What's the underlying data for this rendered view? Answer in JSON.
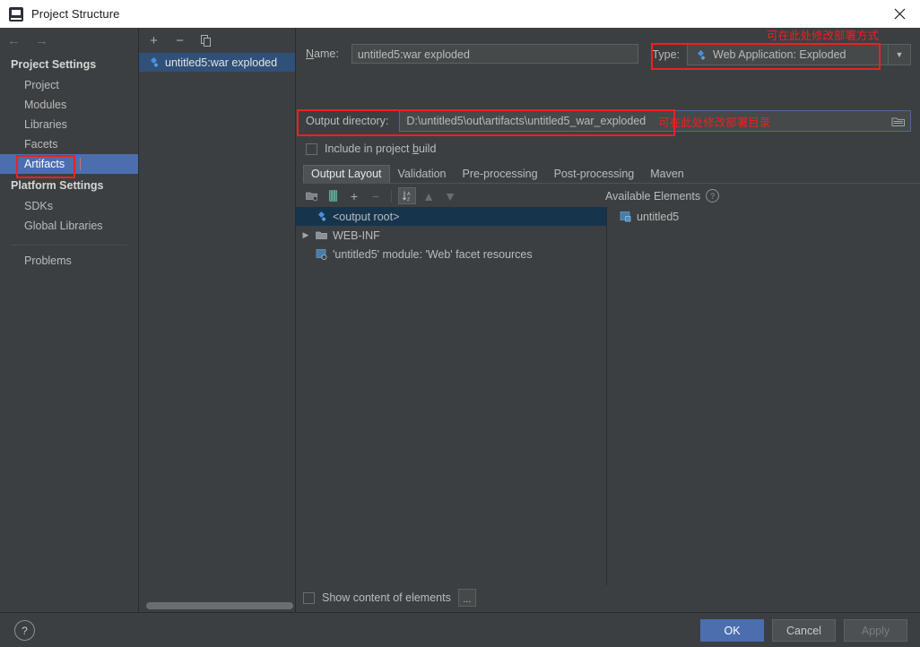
{
  "window": {
    "title": "Project Structure",
    "title_icon": "intellij-idea-icon",
    "close_icon": "close-icon"
  },
  "sidebar": {
    "back_icon": "arrow-left-icon",
    "forward_icon": "arrow-right-icon",
    "groups": [
      {
        "label": "Project Settings",
        "items": [
          {
            "label": "Project",
            "selected": false
          },
          {
            "label": "Modules",
            "selected": false
          },
          {
            "label": "Libraries",
            "selected": false
          },
          {
            "label": "Facets",
            "selected": false
          },
          {
            "label": "Artifacts",
            "selected": true
          }
        ]
      },
      {
        "label": "Platform Settings",
        "items": [
          {
            "label": "SDKs",
            "selected": false
          },
          {
            "label": "Global Libraries",
            "selected": false
          }
        ]
      }
    ],
    "problems": "Problems"
  },
  "artifact_list": {
    "toolbar": [
      {
        "name": "add-artifact-button",
        "glyph": "+"
      },
      {
        "name": "remove-artifact-button",
        "glyph": "−"
      },
      {
        "name": "copy-artifact-button",
        "glyph": "copy-icon"
      }
    ],
    "items": [
      {
        "label": "untitled5:war exploded",
        "icon": "artifact-icon",
        "selected": true
      }
    ]
  },
  "main": {
    "name_label": "Name:",
    "name_label_mnemonic": "N",
    "name_value": "untitled5:war exploded",
    "type_label": "Type:",
    "type_value": "Web Application: Exploded",
    "type_icon": "artifact-icon",
    "type_arrow_icon": "chevron-down-icon",
    "output_dir_label": "Output directory:",
    "output_dir_value": "D:\\untitled5\\out\\artifacts\\untitled5_war_exploded",
    "browse_icon": "folder-browse-icon",
    "include_in_build_label": "Include in project build",
    "include_in_build_mnemonic": "b",
    "include_in_build_checked": false,
    "tabs": [
      {
        "label": "Output Layout",
        "active": true
      },
      {
        "label": "Validation",
        "active": false
      },
      {
        "label": "Pre-processing",
        "active": false
      },
      {
        "label": "Post-processing",
        "active": false
      },
      {
        "label": "Maven",
        "active": false
      }
    ],
    "layout_toolbar": [
      {
        "name": "add-directory-button",
        "glyph": "directory-icon",
        "state": "enabled"
      },
      {
        "name": "add-archive-button",
        "glyph": "archive-icon",
        "state": "enabled"
      },
      {
        "name": "add-element-button",
        "glyph": "+",
        "state": "enabled"
      },
      {
        "name": "remove-element-button",
        "glyph": "−",
        "state": "disabled"
      },
      {
        "name": "sort-elements-button",
        "glyph": "sort-az-icon",
        "state": "toggled"
      },
      {
        "name": "move-up-button",
        "glyph": "▲",
        "state": "disabled"
      },
      {
        "name": "move-down-button",
        "glyph": "▼",
        "state": "disabled"
      }
    ],
    "available_elements_label": "Available Elements",
    "available_help_icon": "help-icon",
    "output_tree": [
      {
        "label": "<output root>",
        "icon": "artifact-icon",
        "indent": 0,
        "twisty": "",
        "selected": true
      },
      {
        "label": "WEB-INF",
        "icon": "folder-icon",
        "indent": 0,
        "twisty": "▶",
        "selected": false
      },
      {
        "label": "'untitled5' module: 'Web' facet resources",
        "icon": "facet-icon",
        "indent": 1,
        "twisty": "",
        "selected": false
      }
    ],
    "available_tree": [
      {
        "label": "untitled5",
        "icon": "module-icon",
        "indent": 0,
        "selected": false
      }
    ],
    "show_content_label": "Show content of elements",
    "show_content_checked": false,
    "show_content_more": "..."
  },
  "annotations": [
    {
      "name": "deployment-type-annotation",
      "text": "可在此处修改部署方式"
    },
    {
      "name": "deployment-dir-annotation",
      "text": "可在此处修改部署目录"
    }
  ],
  "footer": {
    "help_label": "?",
    "ok_label": "OK",
    "cancel_label": "Cancel",
    "apply_label": "Apply"
  },
  "colors": {
    "accent": "#4b6eaf",
    "annotation_red": "#ee2020",
    "background": "#3c3f41",
    "selection": "#2f5079"
  }
}
